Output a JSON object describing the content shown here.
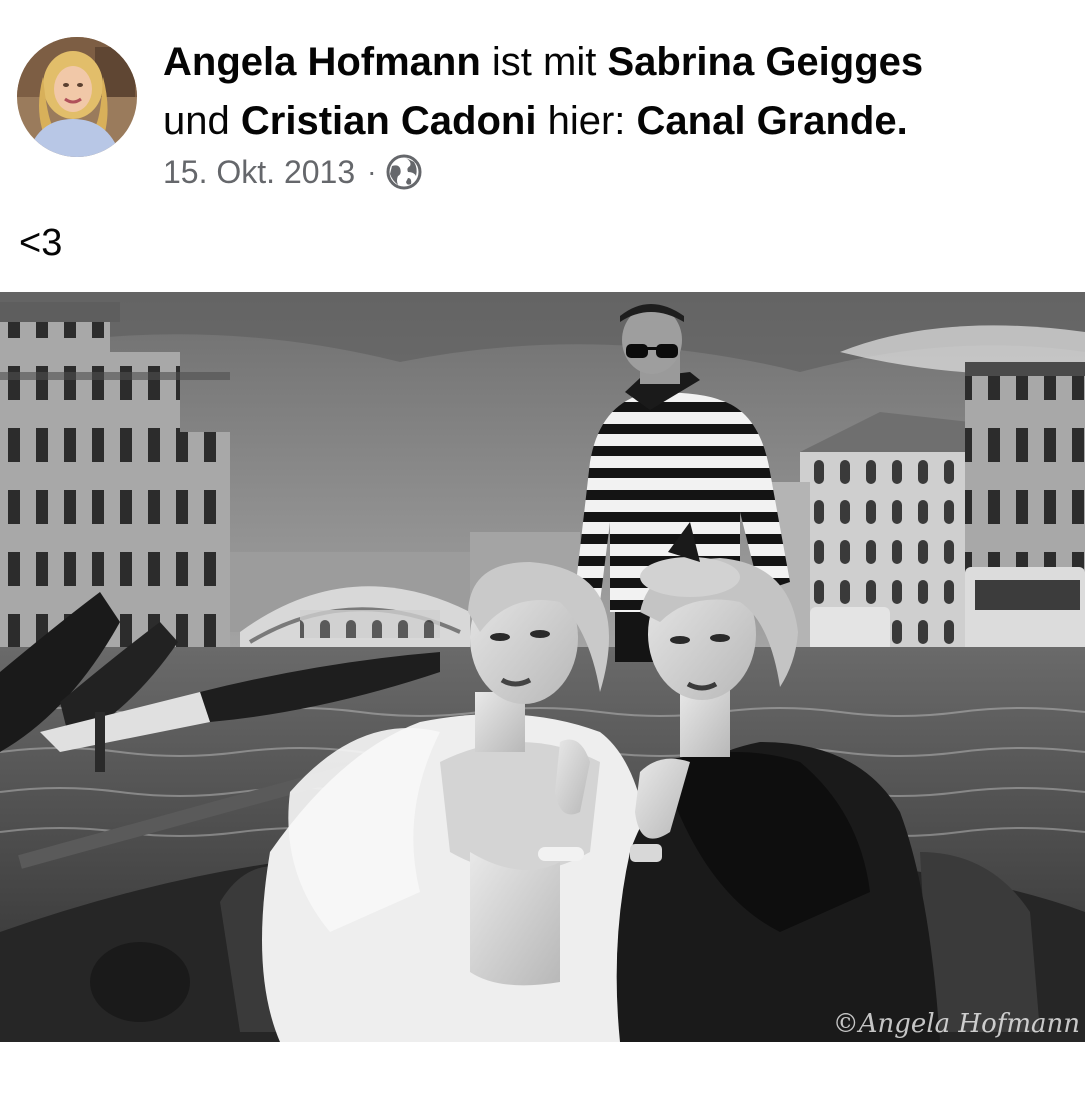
{
  "post": {
    "author": "Angela Hofmann",
    "with_text": "ist mit",
    "tagged_1": "Sabrina Geigges",
    "and_text": "und",
    "tagged_2": "Cristian Cadoni",
    "place_prefix": "hier:",
    "place": "Canal Grande",
    "period": ".",
    "date": "15. Okt. 2013",
    "separator": "·",
    "privacy_icon": "globe-icon",
    "message": "<3"
  },
  "photo": {
    "watermark": "©Angela Hofmann",
    "style": "black-and-white"
  }
}
